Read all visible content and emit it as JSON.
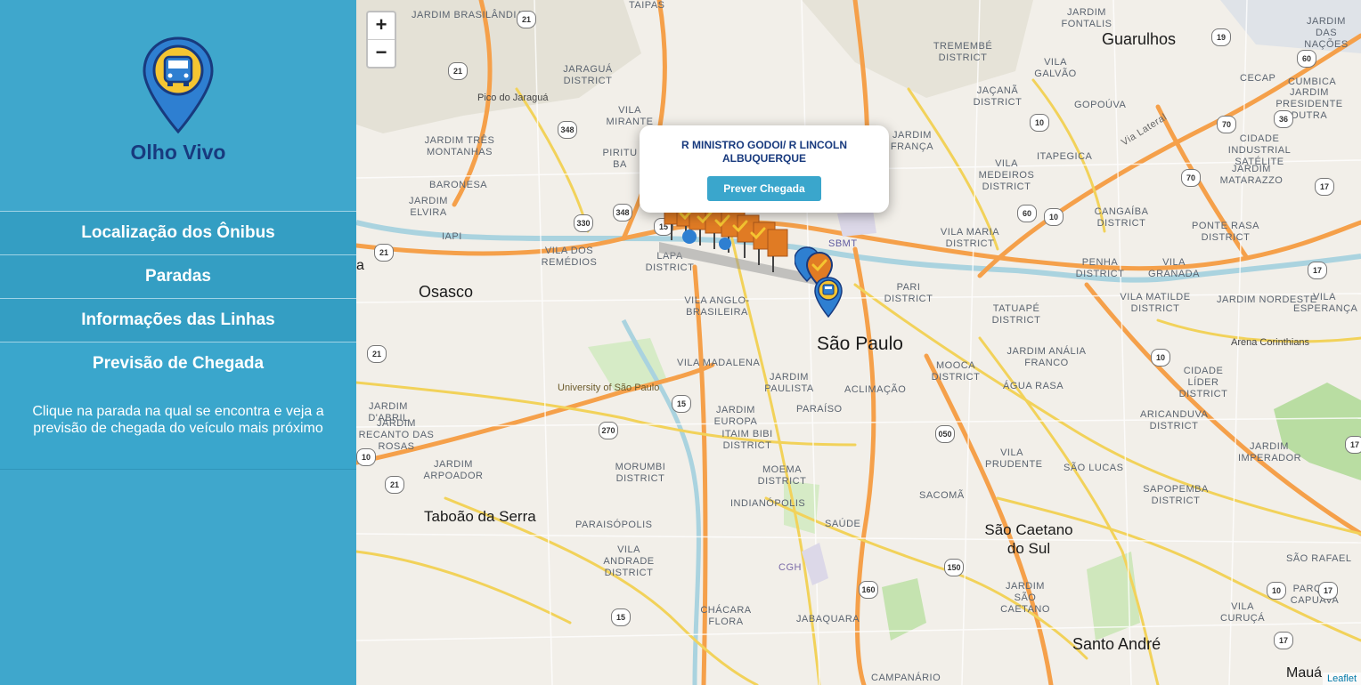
{
  "app": {
    "name": "Olho Vivo"
  },
  "menu": [
    {
      "label": "Localização dos Ônibus"
    },
    {
      "label": "Paradas"
    },
    {
      "label": "Informações das Linhas"
    },
    {
      "label": "Previsão de Chegada"
    }
  ],
  "info_text": "Clique na parada na qual se encontra e veja a previsão de chegada do veículo mais próximo",
  "map": {
    "zoom_in": "+",
    "zoom_out": "−",
    "attribution": "Leaflet",
    "popup": {
      "title": "R MINISTRO GODOI/ R LINCOLN ALBUQUERQUE",
      "button": "Prever Chegada"
    },
    "labels": {
      "brasilandia": "JARDIM BRASILÂNDIA",
      "taipas": "TAIPAS",
      "jaragua": "JARAGUÁ DISTRICT",
      "pico": "Pico do Jaraguá",
      "vila_mirante": "VILA MIRANTE",
      "jardim_tres_montanhas": "JARDIM TRÊS MONTANHAS",
      "baronesa": "BARONESA",
      "jardim_elvira": "JARDIM ELVIRA",
      "iapi": "IAPI",
      "vila_remedios": "VILA DOS REMÉDIOS",
      "lapa": "LAPA DISTRICT",
      "vila_anglo": "VILA ANGLO-BRASILEIRA",
      "vila_madalena": "VILA MADALENA",
      "usp": "University of São Paulo",
      "jardim_paulista": "JARDIM PAULISTA",
      "jardim_europa": "JARDIM EUROPA",
      "itaim_bibi": "ITAIM BIBI DISTRICT",
      "morumbi": "MORUMBI DISTRICT",
      "jardim_arpoador": "JARDIM ARPOADOR",
      "jardim_dabril": "JARDIM D'ABRIL",
      "recanto": "JARDIM RECANTO DAS ROSAS",
      "paraisopolis": "PARAISÓPOLIS",
      "vila_andrade": "VILA ANDRADE DISTRICT",
      "chacara_flora": "CHÁCARA FLORA",
      "moema": "MOEMA DISTRICT",
      "indianopolis": "INDIANÓPOLIS",
      "jabaquara": "JABAQUARA",
      "saude": "SAÚDE",
      "cgh": "CGH",
      "sacoma": "SACOMÃ",
      "aclimacao": "ACLIMAÇÃO",
      "paraiso": "PARAÍSO",
      "mooca": "MOOCA DISTRICT",
      "agua_rasa": "ÁGUA RASA",
      "vila_prudente": "VILA PRUDENTE",
      "sao_lucas": "SÃO LUCAS",
      "jardim_sao_caetano": "JARDIM SÃO CAETANO",
      "pari": "PARI DISTRICT",
      "tatuape": "TATUAPÉ DISTRICT",
      "jardim_analia": "JARDIM ANÁLIA FRANCO",
      "vila_maria": "VILA MARIA DISTRICT",
      "vila_medeiros": "VILA MEDEIROS DISTRICT",
      "tremembe": "TREMEMBÉ DISTRICT",
      "jardim_fontalis": "JARDIM FONTALIS",
      "vila_galvao": "VILA GALVÃO",
      "jacana": "JAÇANÃ DISTRICT",
      "gopouva": "GOPOÚVA",
      "itapegica": "ITAPEGICA",
      "jardim_franca": "JARDIM FRANÇA",
      "sbmt": "SBMT",
      "jardim_nacoes": "JARDIM DAS NAÇÕES",
      "cecap": "CECAP",
      "cumbica": "CUMBICA",
      "jardim_presidente_dutra": "JARDIM PRESIDENTE DUTRA",
      "cidade_industrial": "CIDADE INDUSTRIAL SATÉLITE",
      "jardim_matarazzo": "JARDIM MATARAZZO",
      "cangaiba": "CANGAÍBA DISTRICT",
      "ponte_rasa": "PONTE RASA DISTRICT",
      "penha": "PENHA DISTRICT",
      "vila_granada": "VILA GRANADA",
      "vila_matilde": "VILA MATILDE DISTRICT",
      "jardim_nordeste": "JARDIM NORDESTE",
      "vila_esperanca": "VILA ESPERANÇA",
      "arena": "Arena Corinthians",
      "cidade_lider": "CIDADE LÍDER DISTRICT",
      "aricanduva": "ARICANDUVA DISTRICT",
      "jardim_imperador": "JARDIM IMPERADOR",
      "sapopemba": "SAPOPEMBA DISTRICT",
      "sao_rafael": "SÃO RAFAEL",
      "parque_capuava": "PARQUE CAPUAVA",
      "vila_curuca": "VILA CURUÇÁ",
      "campanario": "CAMPANÁRIO",
      "vila_lateral": "Via Lateral",
      "sao_paulo": "São Paulo",
      "osasco": "Osasco",
      "guarulhos": "Guarulhos",
      "taboao": "Taboão da Serra",
      "sao_caetano": "São Caetano do Sul",
      "santo_andre": "Santo André",
      "maua": "Mauá",
      "edge_a": "a",
      "pirituba": "PIRITU BA"
    },
    "shields": [
      "21",
      "21",
      "348",
      "348",
      "330",
      "15",
      "21",
      "21",
      "270",
      "15",
      "15",
      "21",
      "050",
      "150",
      "160",
      "10",
      "10",
      "10",
      "60",
      "60",
      "70",
      "70",
      "36",
      "17",
      "17",
      "17",
      "10",
      "17",
      "17",
      "19",
      "10"
    ]
  },
  "colors": {
    "sidebar": "#3fa7cc",
    "brand_text": "#183a7e",
    "accent": "#3aa6cc",
    "stop_orange": "#e07b24",
    "bus_blue": "#2e7fd1"
  }
}
